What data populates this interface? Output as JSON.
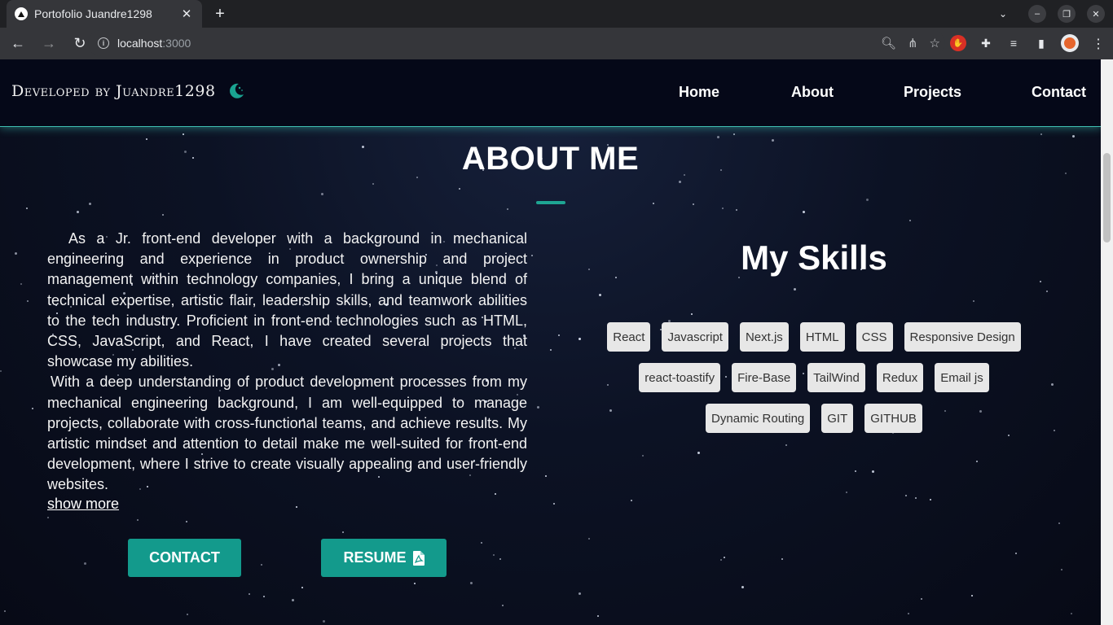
{
  "browser": {
    "tab_title": "Portofolio Juandre1298",
    "url_host": "localhost",
    "url_port": ":3000"
  },
  "site": {
    "brand": "Developed by Juandre1298",
    "nav": [
      "Home",
      "About",
      "Projects",
      "Contact"
    ]
  },
  "about": {
    "title": "ABOUT ME",
    "paragraph1": "As a Jr. front-end developer with a background in mechanical engineering and experience in product ownership and project management within technology companies, I bring a unique blend of technical expertise, artistic flair, leadership skills, and teamwork abilities to the tech industry. Proficient in front-end technologies such as HTML, CSS, JavaScript, and React, I have created several projects that showcase my abilities.",
    "paragraph2": "With a deep understanding of product development processes from my mechanical engineering background, I am well-equipped to manage projects, collaborate with cross-functional teams, and achieve results. My artistic mindset and attention to detail make me well-suited for front-end development, where I strive to create visually appealing and user-friendly websites.",
    "show_more": "show more",
    "contact_button": "CONTACT",
    "resume_button": "RESUME"
  },
  "skills": {
    "title": "My Skills",
    "rows": [
      [
        "React",
        "Javascript",
        "Next.js",
        "HTML",
        "CSS",
        "Responsive Design"
      ],
      [
        "react-toastify",
        "Fire-Base",
        "TailWind",
        "Redux",
        "Email js"
      ],
      [
        "Dynamic Routing",
        "GIT",
        "GITHUB"
      ]
    ]
  },
  "colors": {
    "accent": "#139a8c",
    "nav_background": "#050818",
    "skill_chip": "#e7e7e7"
  }
}
